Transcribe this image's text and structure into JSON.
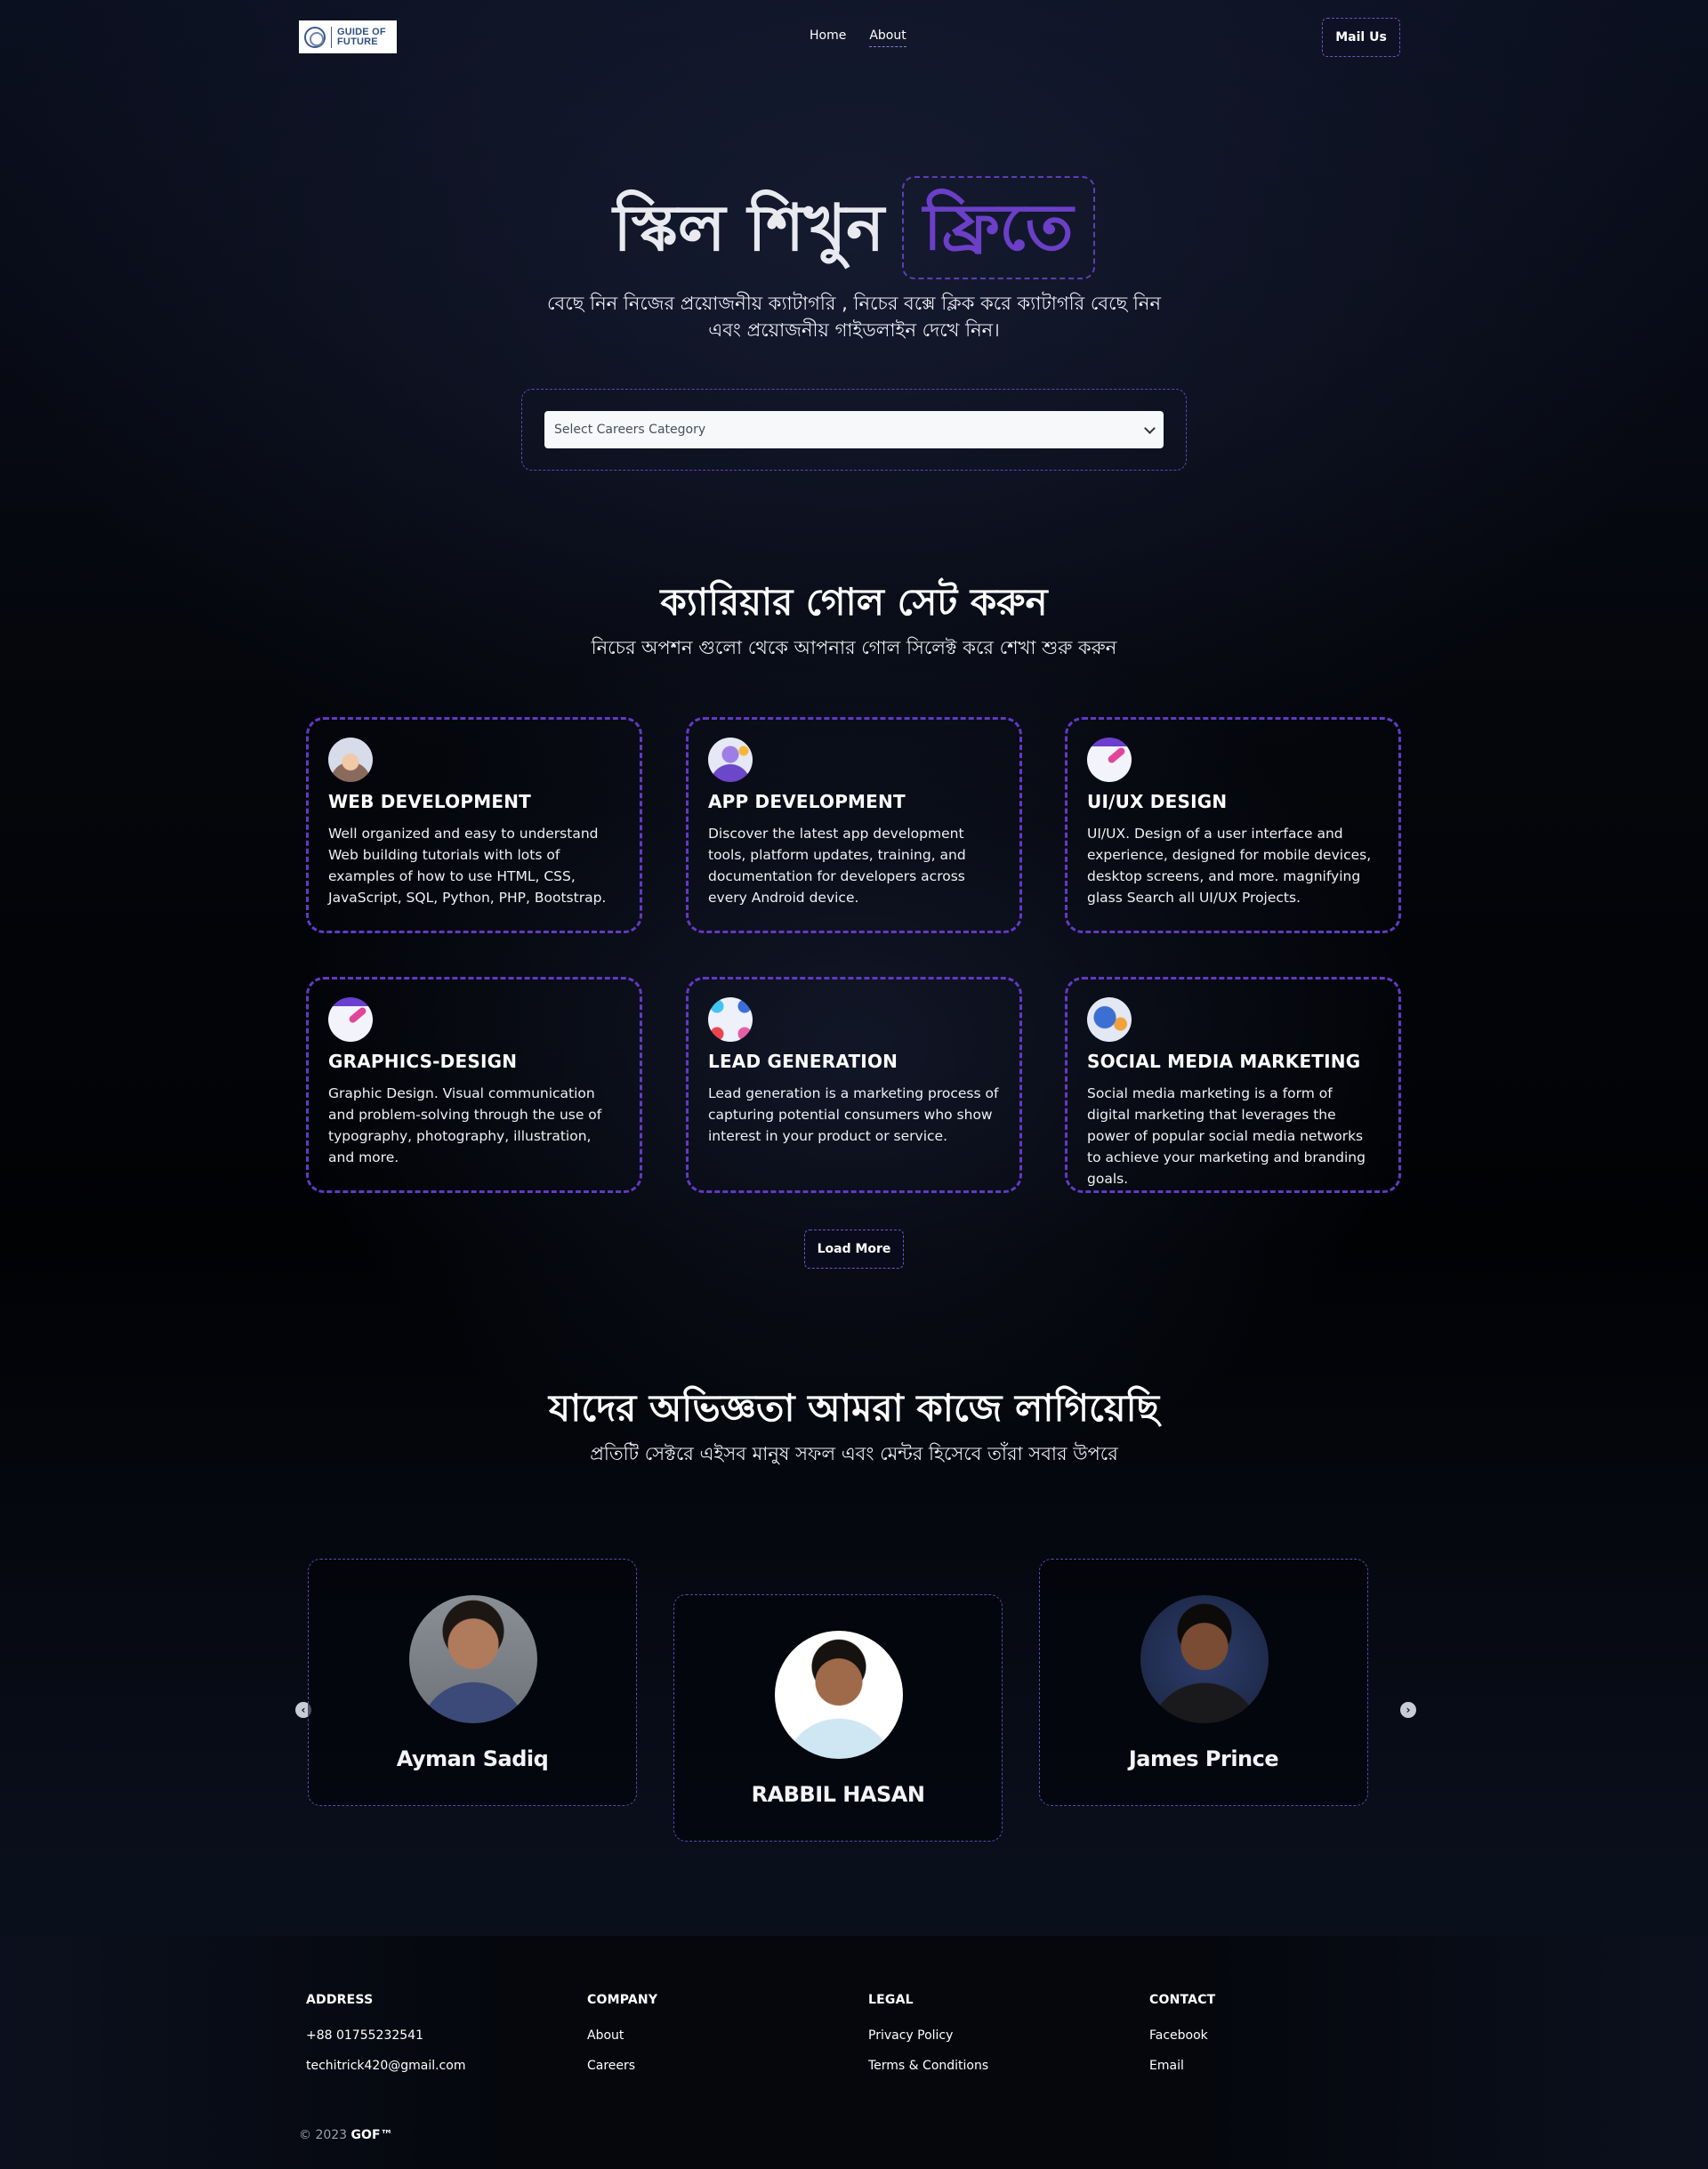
{
  "header": {
    "logo_line1": "GUIDE OF",
    "logo_line2": "FUTURE",
    "nav": [
      "Home",
      "About"
    ],
    "mail_button": "Mail Us"
  },
  "hero": {
    "title_part1": "স্কিল শিখুন",
    "title_part2": "ফ্রিতে",
    "subtitle": "বেছে নিন নিজের প্রয়োজনীয় ক্যাটাগরি , নিচের বক্সে ক্লিক করে ক্যাটাগরি বেছে নিন এবং প্রয়োজনীয় গাইডলাইন দেখে নিন।",
    "select_placeholder": "Select Careers Category"
  },
  "career_section": {
    "title": "ক্যারিয়ার গোল সেট করুন",
    "subtitle": "নিচের অপশন গুলো থেকে আপনার গোল সিলেক্ট করে শেখা শুরু করুন",
    "cards": [
      {
        "title": "WEB DEVELOPMENT",
        "icon": "web-developer-icon",
        "description": "Well organized and easy to understand Web building tutorials with lots of examples of how to use HTML, CSS, JavaScript, SQL, Python, PHP, Bootstrap."
      },
      {
        "title": "APP DEVELOPMENT",
        "icon": "app-developer-icon",
        "description": "Discover the latest app development tools, platform updates, training, and documentation for developers across every Android device."
      },
      {
        "title": "UI/UX DESIGN",
        "icon": "uiux-design-icon",
        "description": "UI/UX. Design of a user interface and experience, designed for mobile devices, desktop screens, and more. magnifying glass Search all UI/UX Projects."
      },
      {
        "title": "GRAPHICS-DESIGN",
        "icon": "graphics-design-icon",
        "description": "Graphic Design. Visual communication and problem-solving through the use of typography, photography, illustration, and more."
      },
      {
        "title": "LEAD GENERATION",
        "icon": "lead-generation-icon",
        "description": "Lead generation is a marketing process of capturing potential consumers who show interest in your product or service."
      },
      {
        "title": "SOCIAL MEDIA MARKETING",
        "icon": "social-media-marketing-icon",
        "description": "Social media marketing is a form of digital marketing that leverages the power of popular social media networks to achieve your marketing and branding goals."
      }
    ],
    "load_more": "Load More"
  },
  "mentor_section": {
    "title": "যাদের অভিজ্ঞতা আমরা কাজে লাগিয়েছি",
    "subtitle": "প্রতিটি সেক্টরে এইসব মানুষ সফল এবং মেন্টর হিসেবে তাঁরা সবার উপরে",
    "mentors": [
      {
        "name": "Ayman Sadiq"
      },
      {
        "name": "RABBIL HASAN"
      },
      {
        "name": "James Prince"
      }
    ],
    "prev_arrow": "‹",
    "next_arrow": "›"
  },
  "footer": {
    "columns": [
      {
        "heading": "ADDRESS",
        "links": [
          "+88 01755232541",
          "techitrick420@gmail.com"
        ]
      },
      {
        "heading": "COMPANY",
        "links": [
          "About",
          "Careers"
        ]
      },
      {
        "heading": "LEGAL",
        "links": [
          "Privacy Policy",
          "Terms & Conditions"
        ]
      },
      {
        "heading": "CONTACT",
        "links": [
          "Facebook",
          "Email"
        ]
      }
    ],
    "copyright_prefix": "© 2023",
    "copyright_brand": "GOF™"
  },
  "colors": {
    "accent_purple": "#6339c6",
    "dashed_border": "#5b47b5",
    "background": "#05070d"
  }
}
